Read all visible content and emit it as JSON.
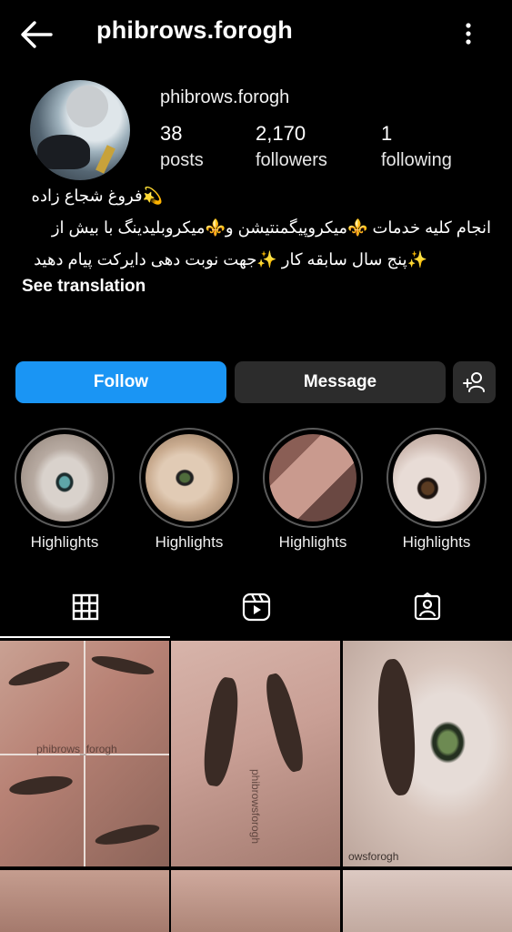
{
  "header": {
    "title": "phibrows.forogh",
    "back_icon": "arrow-left-icon",
    "more_icon": "more-vertical-icon"
  },
  "profile": {
    "username": "phibrows.forogh",
    "stats": [
      {
        "number": "38",
        "label": "posts"
      },
      {
        "number": "2,170",
        "label": "followers"
      },
      {
        "number": "1",
        "label": "following"
      }
    ],
    "bio": {
      "line1": "💫فروغ شجاع زاده",
      "line2": "انجام کلیه خدمات ⚜️میکروپیگمنتیشن و⚜️میکروبلیدینگ با بیش از",
      "line3": "✨پنج سال سابقه کار ✨جهت نوبت دهی دایرکت پیام دهید"
    },
    "see_translation": "See translation"
  },
  "actions": {
    "follow": "Follow",
    "message": "Message",
    "add_user_icon": "add-person-icon"
  },
  "highlights": [
    {
      "label": "Highlights"
    },
    {
      "label": "Highlights"
    },
    {
      "label": "Highlights"
    },
    {
      "label": "Highlights"
    }
  ],
  "tabs": [
    {
      "name": "posts",
      "icon": "grid-icon"
    },
    {
      "name": "reels",
      "icon": "reels-icon"
    },
    {
      "name": "tagged",
      "icon": "tagged-icon"
    }
  ],
  "grid": {
    "watermark_1": "phibrows_forogh",
    "watermark_2": "phibrowsforogh",
    "watermark_3": "owsforogh"
  },
  "colors": {
    "accent": "#1a95f4",
    "background": "#000000",
    "button_dark": "#2c2c2c"
  }
}
